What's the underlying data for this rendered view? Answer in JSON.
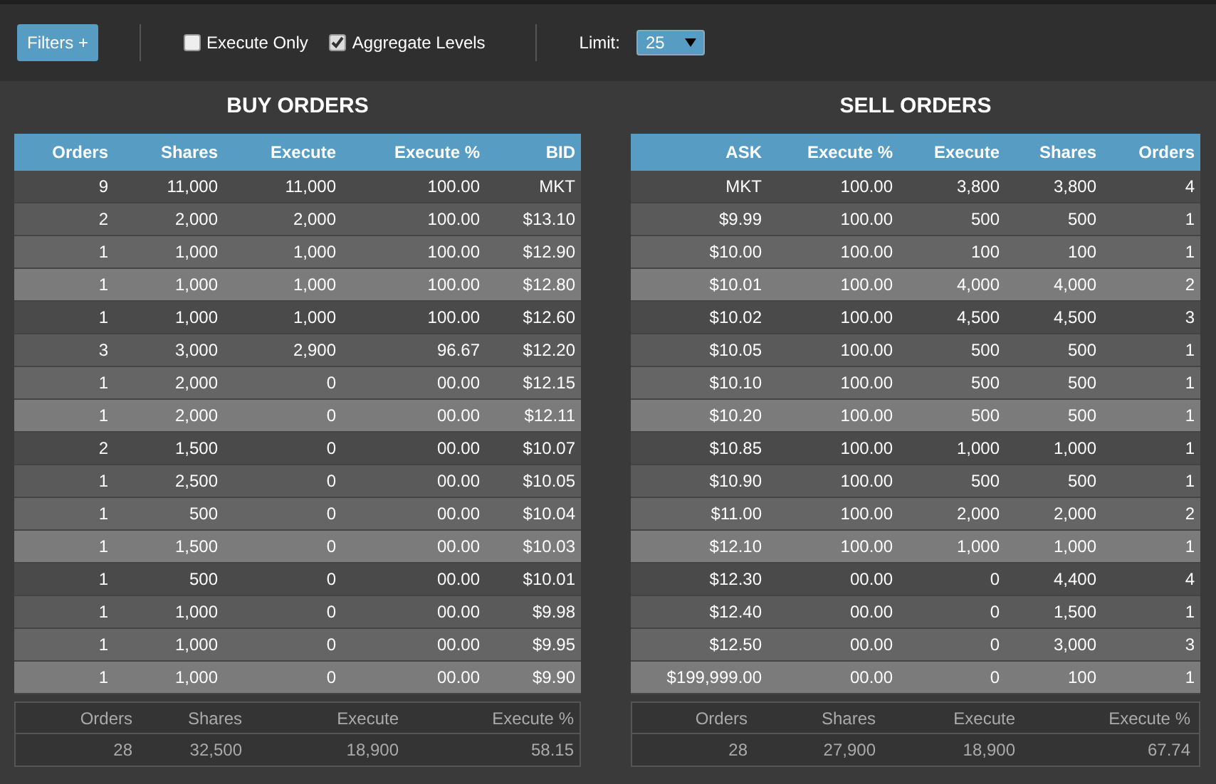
{
  "toolbar": {
    "filters_button": "Filters +",
    "checkboxes": [
      {
        "label": "Execute Only",
        "checked": false
      },
      {
        "label": "Aggregate Levels",
        "checked": true
      }
    ],
    "limit": {
      "label": "Limit:",
      "value": "25"
    }
  },
  "buy_orders": {
    "title": "BUY ORDERS",
    "columns": [
      "Orders",
      "Shares",
      "Execute",
      "Execute %",
      "BID"
    ],
    "rows": [
      [
        "9",
        "11,000",
        "11,000",
        "100.00",
        "MKT"
      ],
      [
        "2",
        "2,000",
        "2,000",
        "100.00",
        "$13.10"
      ],
      [
        "1",
        "1,000",
        "1,000",
        "100.00",
        "$12.90"
      ],
      [
        "1",
        "1,000",
        "1,000",
        "100.00",
        "$12.80"
      ],
      [
        "1",
        "1,000",
        "1,000",
        "100.00",
        "$12.60"
      ],
      [
        "3",
        "3,000",
        "2,900",
        "96.67",
        "$12.20"
      ],
      [
        "1",
        "2,000",
        "0",
        "00.00",
        "$12.15"
      ],
      [
        "1",
        "2,000",
        "0",
        "00.00",
        "$12.11"
      ],
      [
        "2",
        "1,500",
        "0",
        "00.00",
        "$10.07"
      ],
      [
        "1",
        "2,500",
        "0",
        "00.00",
        "$10.05"
      ],
      [
        "1",
        "500",
        "0",
        "00.00",
        "$10.04"
      ],
      [
        "1",
        "1,500",
        "0",
        "00.00",
        "$10.03"
      ],
      [
        "1",
        "500",
        "0",
        "00.00",
        "$10.01"
      ],
      [
        "1",
        "1,000",
        "0",
        "00.00",
        "$9.98"
      ],
      [
        "1",
        "1,000",
        "0",
        "00.00",
        "$9.95"
      ],
      [
        "1",
        "1,000",
        "0",
        "00.00",
        "$9.90"
      ]
    ],
    "summary": {
      "columns": [
        "Orders",
        "Shares",
        "Execute",
        "Execute %"
      ],
      "values": [
        "28",
        "32,500",
        "18,900",
        "58.15"
      ]
    }
  },
  "sell_orders": {
    "title": "SELL ORDERS",
    "columns": [
      "ASK",
      "Execute %",
      "Execute",
      "Shares",
      "Orders"
    ],
    "rows": [
      [
        "MKT",
        "100.00",
        "3,800",
        "3,800",
        "4"
      ],
      [
        "$9.99",
        "100.00",
        "500",
        "500",
        "1"
      ],
      [
        "$10.00",
        "100.00",
        "100",
        "100",
        "1"
      ],
      [
        "$10.01",
        "100.00",
        "4,000",
        "4,000",
        "2"
      ],
      [
        "$10.02",
        "100.00",
        "4,500",
        "4,500",
        "3"
      ],
      [
        "$10.05",
        "100.00",
        "500",
        "500",
        "1"
      ],
      [
        "$10.10",
        "100.00",
        "500",
        "500",
        "1"
      ],
      [
        "$10.20",
        "100.00",
        "500",
        "500",
        "1"
      ],
      [
        "$10.85",
        "100.00",
        "1,000",
        "1,000",
        "1"
      ],
      [
        "$10.90",
        "100.00",
        "500",
        "500",
        "1"
      ],
      [
        "$11.00",
        "100.00",
        "2,000",
        "2,000",
        "2"
      ],
      [
        "$12.10",
        "100.00",
        "1,000",
        "1,000",
        "1"
      ],
      [
        "$12.30",
        "00.00",
        "0",
        "4,400",
        "4"
      ],
      [
        "$12.40",
        "00.00",
        "0",
        "1,500",
        "1"
      ],
      [
        "$12.50",
        "00.00",
        "0",
        "3,000",
        "3"
      ],
      [
        "$199,999.00",
        "00.00",
        "0",
        "100",
        "1"
      ]
    ],
    "summary": {
      "columns": [
        "Orders",
        "Shares",
        "Execute",
        "Execute %"
      ],
      "values": [
        "28",
        "27,900",
        "18,900",
        "67.74"
      ]
    }
  }
}
